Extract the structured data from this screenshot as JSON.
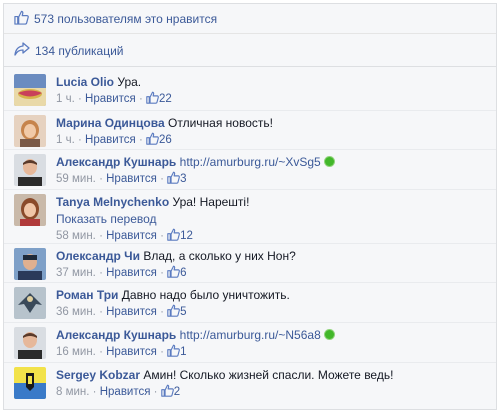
{
  "likes_bar": {
    "count": "573",
    "text": "пользователям это нравится"
  },
  "shares_bar": {
    "count": "134",
    "text": "публикаций"
  },
  "comments": [
    {
      "author": "Lucia Olio",
      "text": "Ура.",
      "time": "1 ч.",
      "like_label": "Нравится",
      "likes": "22"
    },
    {
      "author": "Марина Одинцова",
      "text": "Отличная новость!",
      "time": "1 ч.",
      "like_label": "Нравится",
      "likes": "26"
    },
    {
      "author": "Александр Кушнарь",
      "text": "http://amurburg.ru/~XvSg5",
      "time": "59 мин.",
      "like_label": "Нравится",
      "likes": "3"
    },
    {
      "author": "Tanya Melnychenko",
      "text": "Ура! Нарешті!",
      "translate": "Показать перевод",
      "time": "58 мин.",
      "like_label": "Нравится",
      "likes": "12"
    },
    {
      "author": "Олександр Чи",
      "text": "Влад, а сколько у них Нон?",
      "time": "37 мин.",
      "like_label": "Нравится",
      "likes": "6"
    },
    {
      "author": "Роман Три",
      "text": "Давно надо было уничтожить.",
      "time": "36 мин.",
      "like_label": "Нравится",
      "likes": "5"
    },
    {
      "author": "Александр Кушнарь",
      "text": "http://amurburg.ru/~N56a8",
      "time": "16 мин.",
      "like_label": "Нравится",
      "likes": "1"
    },
    {
      "author": "Sergey Kobzar",
      "text": "Амин! Сколько жизней спасли. Можете ведь!",
      "time": "8 мин.",
      "like_label": "Нравится",
      "likes": "2"
    }
  ],
  "separator": "·",
  "colors": {
    "link": "#3b5998",
    "meta": "#9197a3",
    "online": "#42b72a",
    "panel": "#f6f7f9"
  },
  "icons": {
    "like": "thumbs-up-icon",
    "share": "share-arrow-icon",
    "online": "online-dot-icon"
  }
}
